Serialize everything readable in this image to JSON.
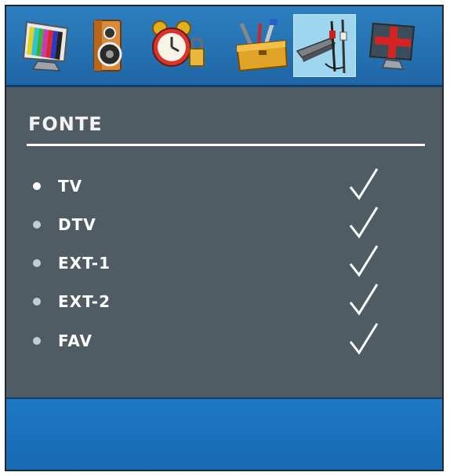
{
  "menu": {
    "tabs": [
      {
        "icon": "picture-icon"
      },
      {
        "icon": "speaker-icon"
      },
      {
        "icon": "alarm-clock-icon"
      },
      {
        "icon": "toolbox-icon"
      },
      {
        "icon": "cables-icon",
        "selected": true
      },
      {
        "icon": "red-cross-screen-icon"
      }
    ],
    "title": "FONTE",
    "items": [
      {
        "label": "TV",
        "checked": true,
        "active": true
      },
      {
        "label": "DTV",
        "checked": true
      },
      {
        "label": "EXT-1",
        "checked": true
      },
      {
        "label": "EXT-2",
        "checked": true
      },
      {
        "label": "FAV",
        "checked": true
      }
    ]
  },
  "colors": {
    "header_blue": "#2d7fc0",
    "panel_gray": "#505c63",
    "selected_tab": "#9fd6ef",
    "text": "#ffffff"
  }
}
